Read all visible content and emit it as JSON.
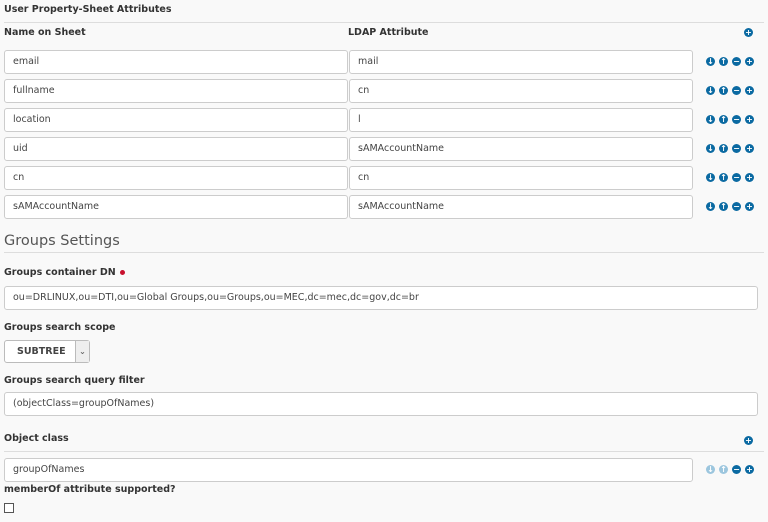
{
  "property_sheet": {
    "title": "User Property-Sheet Attributes",
    "col_name": "Name on Sheet",
    "col_ldap": "LDAP Attribute",
    "rows": [
      {
        "name": "email",
        "ldap": "mail"
      },
      {
        "name": "fullname",
        "ldap": "cn"
      },
      {
        "name": "location",
        "ldap": "l"
      },
      {
        "name": "uid",
        "ldap": "sAMAccountName"
      },
      {
        "name": "cn",
        "ldap": "cn"
      },
      {
        "name": "sAMAccountName",
        "ldap": "sAMAccountName"
      }
    ]
  },
  "groups": {
    "heading": "Groups Settings",
    "container_dn_label": "Groups container DN",
    "container_dn_value": "ou=DRLINUX,ou=DTI,ou=Global Groups,ou=Groups,ou=MEC,dc=mec,dc=gov,dc=br",
    "scope_label": "Groups search scope",
    "scope_value": "SUBTREE",
    "filter_label": "Groups search query filter",
    "filter_value": "(objectClass=groupOfNames)",
    "object_class_label": "Object class",
    "object_class_value": "groupOfNames",
    "memberof_label": "memberOf attribute supported?",
    "memberof_checked": false
  },
  "colors": {
    "accent": "#0b6aa2",
    "required": "#c8102e"
  },
  "icons": [
    "move-down-icon",
    "move-up-icon",
    "remove-icon",
    "add-icon"
  ]
}
